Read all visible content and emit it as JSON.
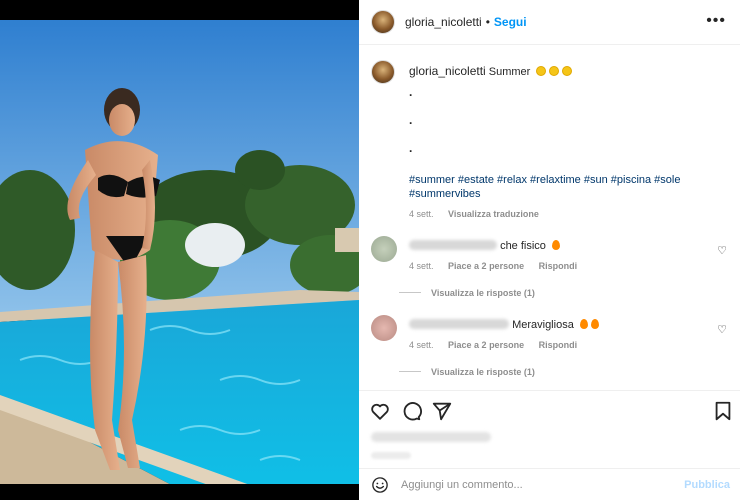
{
  "post": {
    "username": "gloria_nicoletti",
    "separator": "•",
    "follow_label": "Segui",
    "more_label": "•••"
  },
  "caption": {
    "username": "gloria_nicoletti",
    "text": "Summer",
    "emoji_count": 3,
    "dot_lines": [
      ".",
      ".",
      "."
    ],
    "hashtags": "#summer #estate #relax #relaxtime #sun #piscina #sole #summervibes",
    "time": "4 sett.",
    "translate_label": "Visualizza traduzione"
  },
  "comments": [
    {
      "text": "che fisico",
      "emoji": "fire",
      "time": "4 sett.",
      "likes_label": "Piace a 2 persone",
      "reply_label": "Rispondi",
      "view_replies": "Visualizza le risposte (1)"
    },
    {
      "text": "Meravigliosa",
      "emoji": "fire fire",
      "time": "4 sett.",
      "likes_label": "Piace a 2 persone",
      "reply_label": "Rispondi",
      "view_replies": "Visualizza le risposte (1)"
    }
  ],
  "actions": {
    "icons": [
      "heart-icon",
      "comment-icon",
      "share-icon",
      "bookmark-icon"
    ]
  },
  "add_comment": {
    "placeholder": "Aggiungi un commento...",
    "post_label": "Pubblica"
  },
  "colors": {
    "follow_blue": "#0095f6",
    "hashtag_blue": "#00376b",
    "post_disabled": "#b3dbff",
    "muted_text": "#8e8e8e"
  }
}
